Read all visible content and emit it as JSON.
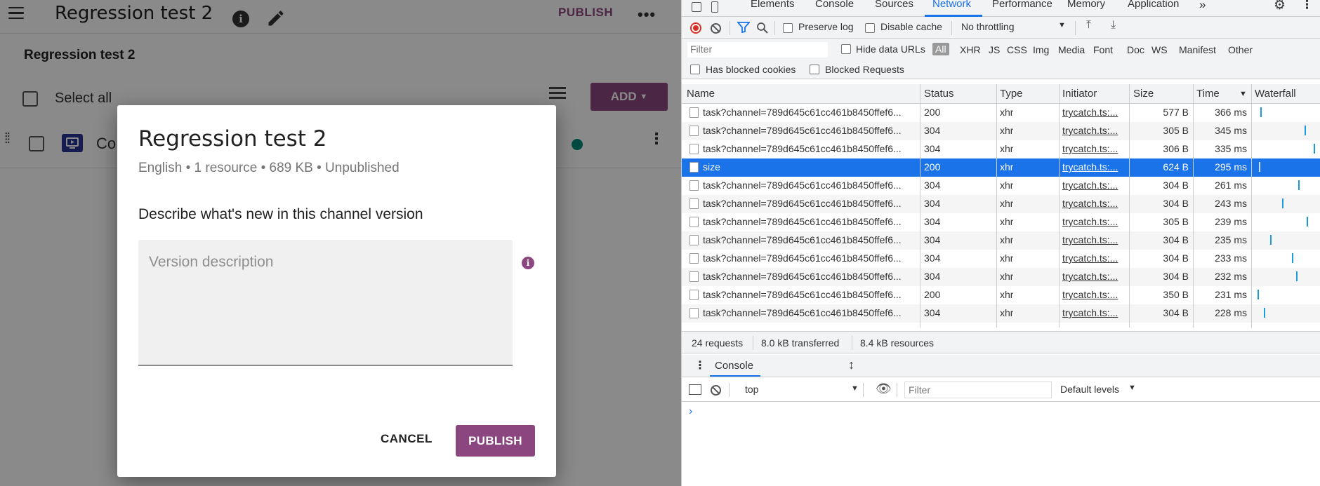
{
  "app": {
    "title": "Regression test 2",
    "publish_label": "PUBLISH",
    "channel_heading": "Regression test 2",
    "select_all_label": "Select all",
    "add_label": "ADD",
    "row_title": "Co"
  },
  "dialog": {
    "title": "Regression test 2",
    "subtitle": "English • 1 resource • 689 KB • Unpublished",
    "prompt": "Describe what's new in this channel version",
    "placeholder": "Version description",
    "cancel_label": "CANCEL",
    "publish_label": "PUBLISH",
    "accent_color": "#8b4680"
  },
  "devtools": {
    "tabs": [
      "Elements",
      "Console",
      "Sources",
      "Network",
      "Performance",
      "Memory",
      "Application"
    ],
    "active_tab": "Network",
    "toolbar": {
      "preserve_log": "Preserve log",
      "disable_cache": "Disable cache",
      "throttling": "No throttling"
    },
    "filter": {
      "placeholder": "Filter",
      "hide_data_urls": "Hide data URLs",
      "types": [
        "All",
        "XHR",
        "JS",
        "CSS",
        "Img",
        "Media",
        "Font",
        "Doc",
        "WS",
        "Manifest",
        "Other"
      ],
      "has_blocked_cookies": "Has blocked cookies",
      "blocked_requests": "Blocked Requests"
    },
    "columns": [
      "Name",
      "Status",
      "Type",
      "Initiator",
      "Size",
      "Time",
      "Waterfall"
    ],
    "rows": [
      {
        "name": "task?channel=789d645c61cc461b8450ffef6...",
        "status": "200",
        "type": "xhr",
        "initiator": "trycatch.ts:...",
        "size": "577 B",
        "time": "366 ms",
        "wf": 0.09
      },
      {
        "name": "task?channel=789d645c61cc461b8450ffef6...",
        "status": "304",
        "type": "xhr",
        "initiator": "trycatch.ts:...",
        "size": "305 B",
        "time": "345 ms",
        "wf": 0.85
      },
      {
        "name": "task?channel=789d645c61cc461b8450ffef6...",
        "status": "304",
        "type": "xhr",
        "initiator": "trycatch.ts:...",
        "size": "306 B",
        "time": "335 ms",
        "wf": 1.0
      },
      {
        "name": "size",
        "status": "200",
        "type": "xhr",
        "initiator": "trycatch.ts:...",
        "size": "624 B",
        "time": "295 ms",
        "wf": 0.07,
        "selected": true
      },
      {
        "name": "task?channel=789d645c61cc461b8450ffef6...",
        "status": "304",
        "type": "xhr",
        "initiator": "trycatch.ts:...",
        "size": "304 B",
        "time": "261 ms",
        "wf": 0.74
      },
      {
        "name": "task?channel=789d645c61cc461b8450ffef6...",
        "status": "304",
        "type": "xhr",
        "initiator": "trycatch.ts:...",
        "size": "304 B",
        "time": "243 ms",
        "wf": 0.47
      },
      {
        "name": "task?channel=789d645c61cc461b8450ffef6...",
        "status": "304",
        "type": "xhr",
        "initiator": "trycatch.ts:...",
        "size": "305 B",
        "time": "239 ms",
        "wf": 0.88
      },
      {
        "name": "task?channel=789d645c61cc461b8450ffef6...",
        "status": "304",
        "type": "xhr",
        "initiator": "trycatch.ts:...",
        "size": "304 B",
        "time": "235 ms",
        "wf": 0.26
      },
      {
        "name": "task?channel=789d645c61cc461b8450ffef6...",
        "status": "304",
        "type": "xhr",
        "initiator": "trycatch.ts:...",
        "size": "304 B",
        "time": "233 ms",
        "wf": 0.63
      },
      {
        "name": "task?channel=789d645c61cc461b8450ffef6...",
        "status": "304",
        "type": "xhr",
        "initiator": "trycatch.ts:...",
        "size": "304 B",
        "time": "232 ms",
        "wf": 0.7
      },
      {
        "name": "task?channel=789d645c61cc461b8450ffef6...",
        "status": "200",
        "type": "xhr",
        "initiator": "trycatch.ts:...",
        "size": "350 B",
        "time": "231 ms",
        "wf": 0.05
      },
      {
        "name": "task?channel=789d645c61cc461b8450ffef6...",
        "status": "304",
        "type": "xhr",
        "initiator": "trycatch.ts:...",
        "size": "304 B",
        "time": "228 ms",
        "wf": 0.15
      }
    ],
    "summary": {
      "requests": "24 requests",
      "transferred": "8.0 kB transferred",
      "resources": "8.4 kB resources"
    },
    "drawer": {
      "console_tab": "Console",
      "context": "top",
      "filter_placeholder": "Filter",
      "levels": "Default levels",
      "prompt": "›"
    },
    "colors": {
      "accent": "#1a73e8",
      "record": "#d93025",
      "waterfall": "#1a9bd8"
    }
  }
}
